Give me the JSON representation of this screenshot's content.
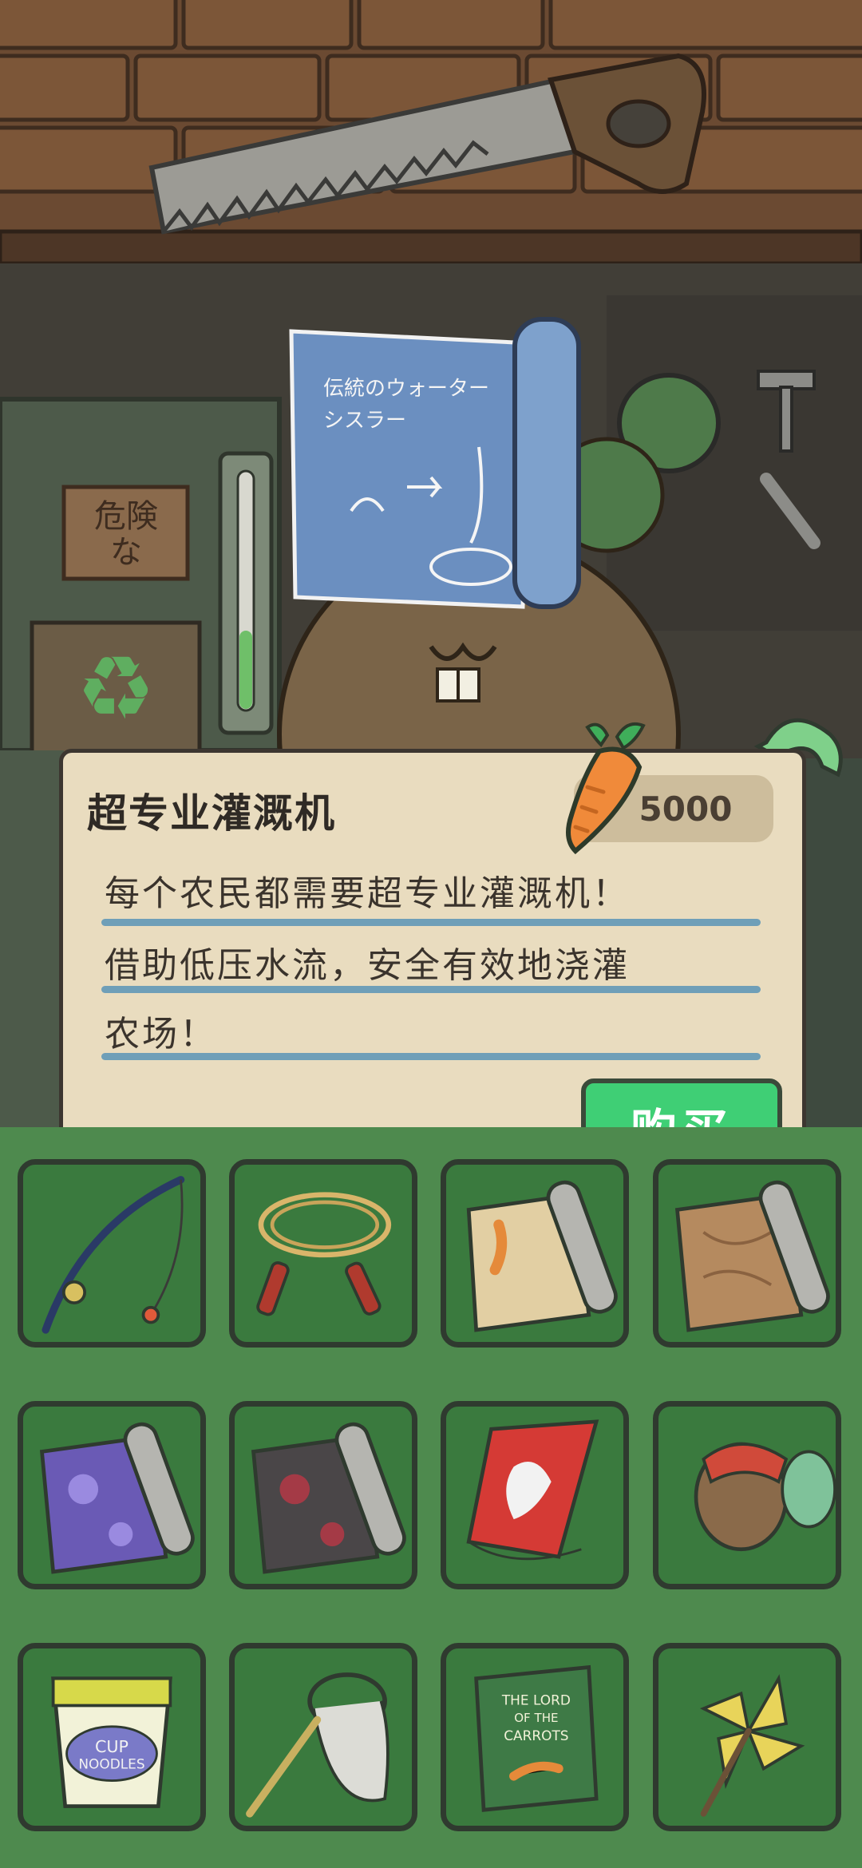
{
  "item": {
    "name": "超专业灌溉机",
    "price": "5000",
    "description_lines": [
      "每个农民都需要超专业灌溉机！",
      "借助低压水流，安全有效地浇灌",
      "农场！"
    ],
    "buy_label": "购买"
  },
  "background_text": {
    "warning_sign": "危険な",
    "blueprint_title": "伝統のウォーターシスラー",
    "book_title": "THE LORD OF THE CARROTS",
    "cup_label": "CUP NOODLES"
  },
  "shelf": {
    "items": [
      {
        "icon": "fishing-rod-icon"
      },
      {
        "icon": "jump-rope-icon"
      },
      {
        "icon": "carrot-scroll-icon"
      },
      {
        "icon": "wood-scroll-icon"
      },
      {
        "icon": "purple-sakura-scroll-icon"
      },
      {
        "icon": "dark-sakura-scroll-icon"
      },
      {
        "icon": "kite-icon"
      },
      {
        "icon": "spinning-top-icon"
      },
      {
        "icon": "cup-noodles-icon"
      },
      {
        "icon": "bug-net-icon"
      },
      {
        "icon": "lord-of-the-carrots-book-icon"
      },
      {
        "icon": "pinwheel-icon"
      }
    ]
  },
  "colors": {
    "buy_button": "#3fcf75",
    "card_background": "#e9dcbf",
    "shelf_green": "#4e8a4e",
    "text_rule_blue": "#6f9fb8"
  }
}
